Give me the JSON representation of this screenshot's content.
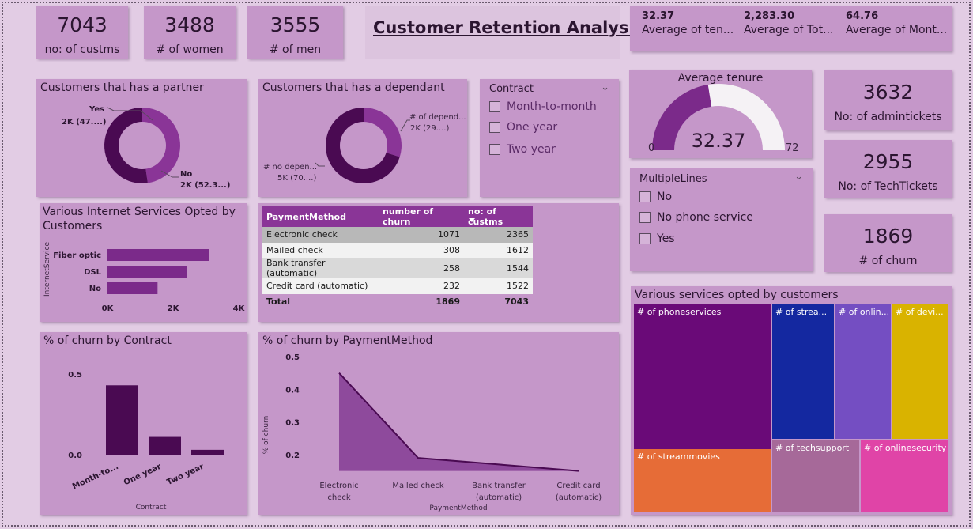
{
  "title": "Customer Retention Analysis",
  "kpis": {
    "customers": {
      "value": "7043",
      "label": "no: of custms"
    },
    "women": {
      "value": "3488",
      "label": "# of women"
    },
    "men": {
      "value": "3555",
      "label": "# of men"
    },
    "admintickets": {
      "value": "3632",
      "label": "No: of admintickets"
    },
    "techtickets": {
      "value": "2955",
      "label": "No: of TechTickets"
    },
    "churn": {
      "value": "1869",
      "label": "# of churn"
    }
  },
  "multi_kpi": [
    {
      "value": "32.37",
      "label": "Average of ten..."
    },
    {
      "value": "2,283.30",
      "label": "Average of Tot..."
    },
    {
      "value": "64.76",
      "label": "Average of Mont..."
    }
  ],
  "colors": {
    "background": "#e2cce4",
    "card": "#c597c9",
    "dark_purple": "#4a0a52",
    "mid_purple": "#8a3597",
    "bar_purple": "#7b2a8a"
  },
  "contract_slicer": {
    "title": "Contract",
    "options": [
      "Month-to-month",
      "One year",
      "Two year"
    ]
  },
  "multiplelines_slicer": {
    "title": "MultipleLines",
    "options": [
      "No",
      "No phone service",
      "Yes"
    ]
  },
  "payment_table": {
    "headers": [
      "PaymentMethod",
      "number of churn",
      "no: of custms"
    ],
    "rows": [
      [
        "Electronic check",
        "1071",
        "2365"
      ],
      [
        "Mailed check",
        "308",
        "1612"
      ],
      [
        "Bank transfer (automatic)",
        "258",
        "1544"
      ],
      [
        "Credit card (automatic)",
        "232",
        "1522"
      ]
    ],
    "total": [
      "Total",
      "1869",
      "7043"
    ]
  },
  "chart_data": [
    {
      "type": "pie",
      "title": "Customers that has a partner",
      "slices": [
        {
          "name": "Yes",
          "value": 47.7,
          "label": "2K (47....)",
          "color": "#8a3597"
        },
        {
          "name": "No",
          "value": 52.3,
          "label": "2K (52.3...)",
          "color": "#4a0a52"
        }
      ]
    },
    {
      "type": "pie",
      "title": "Customers that has a dependant",
      "slices": [
        {
          "name": "# of depend...",
          "value": 29.9,
          "label": "2K (29....)",
          "color": "#8a3597"
        },
        {
          "name": "# no depen...",
          "value": 70.1,
          "label": "5K (70....)",
          "color": "#4a0a52"
        }
      ]
    },
    {
      "type": "bar",
      "title": "Various Internet Services Opted by Customers",
      "orientation": "horizontal",
      "categories": [
        "Fiber optic",
        "DSL",
        "No"
      ],
      "values": [
        3096,
        2421,
        1526
      ],
      "ylabel": "InternetService",
      "xlim": [
        0,
        4000
      ],
      "ticks": [
        "0K",
        "2K",
        "4K"
      ]
    },
    {
      "type": "gauge",
      "title": "Average tenure",
      "value": 32.37,
      "value_label": "32.37",
      "min": 0,
      "max": 72
    },
    {
      "type": "bar",
      "title": "% of churn by Contract",
      "categories": [
        "Month-to...",
        "One year",
        "Two year"
      ],
      "values": [
        0.43,
        0.11,
        0.03
      ],
      "xlabel": "Contract",
      "yticks": [
        "0.5",
        "0.0"
      ],
      "ylim": [
        0,
        0.5
      ]
    },
    {
      "type": "area",
      "title": "% of churn by PaymentMethod",
      "categories": [
        "Electronic check",
        "Mailed check",
        "Bank transfer (automatic)",
        "Credit card (automatic)"
      ],
      "category_lines": [
        [
          "Electronic",
          "check"
        ],
        [
          "Mailed check"
        ],
        [
          "Bank transfer",
          "(automatic)"
        ],
        [
          "Credit card",
          "(automatic)"
        ]
      ],
      "values": [
        0.45,
        0.19,
        0.17,
        0.15
      ],
      "xlabel": "PaymentMethod",
      "ylabel": "% of churn",
      "yticks": [
        "0.5",
        "0.4",
        "0.3",
        "0.2"
      ],
      "ylim": [
        0.15,
        0.5
      ]
    },
    {
      "type": "treemap",
      "title": "Various services opted by customers",
      "items": [
        {
          "name": "# of phoneservices",
          "color": "#6a0a78"
        },
        {
          "name": "# of strea...",
          "color": "#1428a0"
        },
        {
          "name": "# of onlin...",
          "color": "#744ec2"
        },
        {
          "name": "# of devi...",
          "color": "#d9b300"
        },
        {
          "name": "# of streammovies",
          "color": "#e66c37"
        },
        {
          "name": "# of techsupport",
          "color": "#a66999"
        },
        {
          "name": "# of onlinesecurity",
          "color": "#e044a7"
        }
      ]
    }
  ]
}
